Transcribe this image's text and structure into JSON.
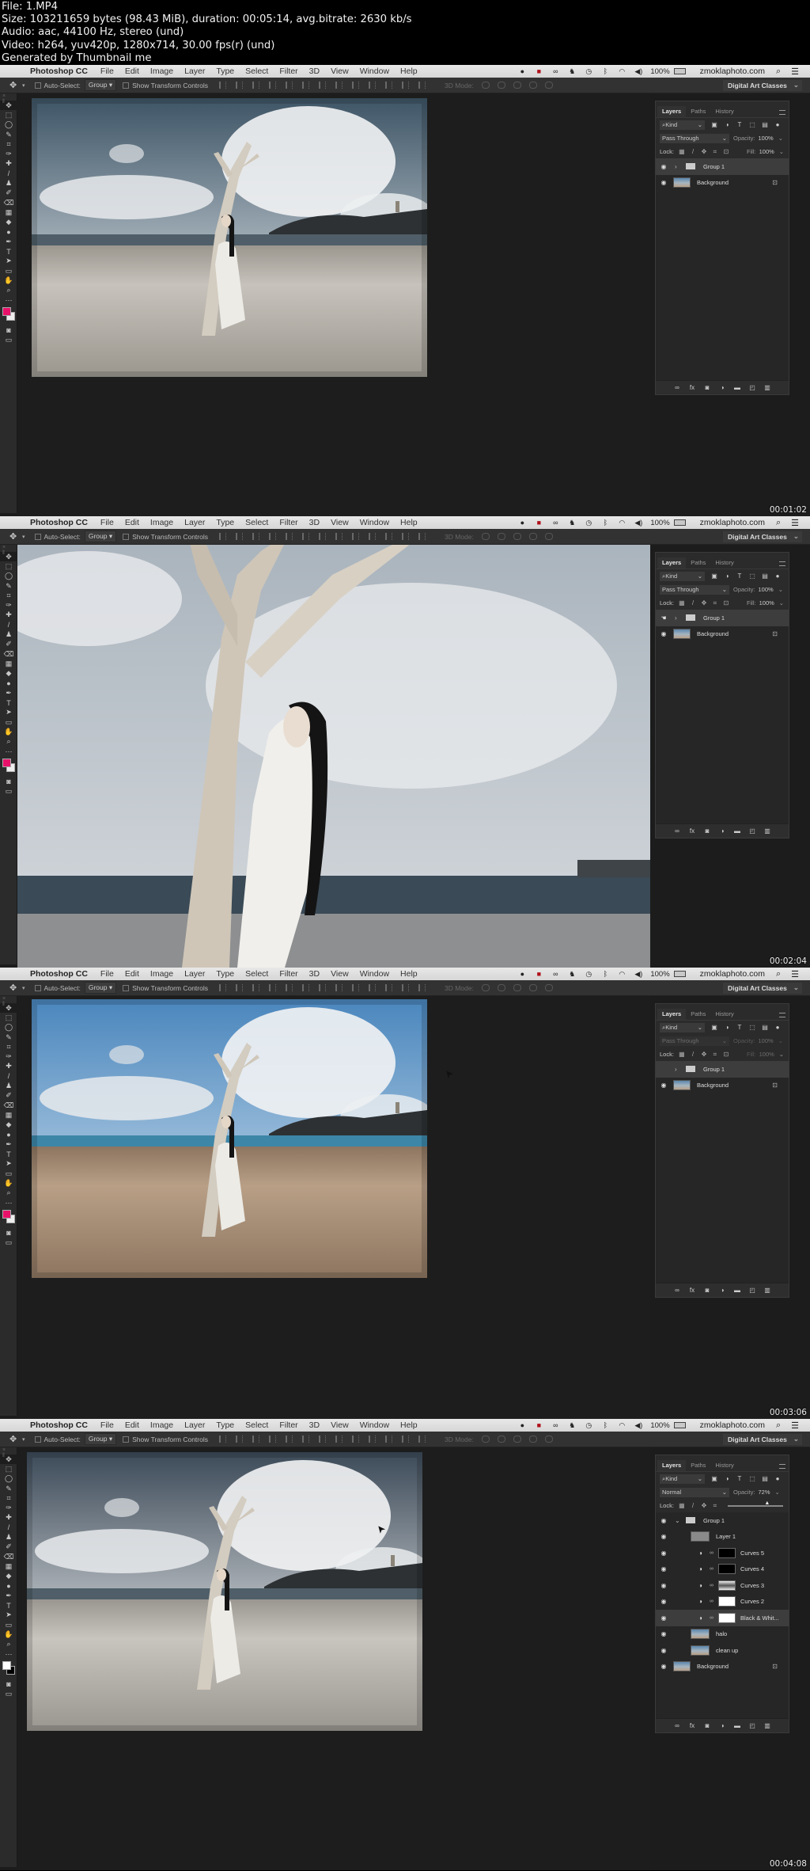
{
  "file_info": {
    "file": "File: 1.MP4",
    "size": "Size: 103211659 bytes (98.43 MiB), duration: 00:05:14, avg.bitrate: 2630 kb/s",
    "audio": "Audio: aac, 44100 Hz, stereo (und)",
    "video": "Video: h264, yuv420p, 1280x714, 30.00 fps(r) (und)",
    "generator": "Generated by Thumbnail me"
  },
  "menubar": {
    "app_name": "Photoshop CC",
    "items": [
      "File",
      "Edit",
      "Image",
      "Layer",
      "Type",
      "Select",
      "Filter",
      "3D",
      "View",
      "Window",
      "Help"
    ],
    "battery": "100%",
    "site": "zmoklaphoto.com"
  },
  "options_bar": {
    "auto_select_label": "Auto-Select:",
    "auto_select_value": "Group",
    "transform_label": "Show Transform Controls",
    "mode_label": "3D Mode:",
    "workspace": "Digital Art Classes"
  },
  "tools": [
    "move",
    "marquee",
    "lasso",
    "quick-select",
    "crop",
    "eyedropper",
    "healing",
    "brush",
    "stamp",
    "history-brush",
    "eraser",
    "gradient",
    "blur",
    "dodge",
    "pen",
    "type",
    "path-select",
    "rectangle",
    "hand",
    "zoom",
    "more"
  ],
  "panel": {
    "tabs": [
      "Layers",
      "Paths",
      "History"
    ],
    "kind_label": "Kind",
    "opacity_label": "Opacity:",
    "fill_label": "Fill:",
    "lock_label": "Lock:"
  },
  "frames": [
    {
      "timestamp": "00:01:02",
      "fg_color": "#e8116a",
      "bg_color": "#eeeeee",
      "blend_mode": "Pass Through",
      "opacity": "100%",
      "fill": "100%",
      "controls_dimmed": false,
      "layers": [
        {
          "name": "Group 1",
          "type": "group",
          "visible": true,
          "selected": true
        },
        {
          "name": "Background",
          "type": "image",
          "visible": true,
          "locked": true
        }
      ]
    },
    {
      "timestamp": "00:02:04",
      "fg_color": "#e8116a",
      "bg_color": "#eeeeee",
      "blend_mode": "Pass Through",
      "opacity": "100%",
      "fill": "100%",
      "controls_dimmed": false,
      "layers": [
        {
          "name": "Group 1",
          "type": "group",
          "visible": true,
          "selected": true
        },
        {
          "name": "Background",
          "type": "image",
          "visible": true,
          "locked": true
        }
      ]
    },
    {
      "timestamp": "00:03:06",
      "fg_color": "#e8116a",
      "bg_color": "#eeeeee",
      "blend_mode": "Pass Through",
      "opacity": "100%",
      "fill": "100%",
      "controls_dimmed": true,
      "layers": [
        {
          "name": "Group 1",
          "type": "group",
          "visible": false,
          "selected": true
        },
        {
          "name": "Background",
          "type": "image",
          "visible": true,
          "locked": true
        }
      ]
    },
    {
      "timestamp": "00:04:08",
      "fg_color": "#ffffff",
      "bg_color": "#000000",
      "blend_mode": "Normal",
      "opacity": "72%",
      "opacity_slider": 0.72,
      "controls_dimmed": false,
      "layers": [
        {
          "name": "Group 1",
          "type": "group-open",
          "visible": true
        },
        {
          "name": "Layer 1",
          "type": "gray",
          "visible": true
        },
        {
          "name": "Curves 5",
          "type": "adjust",
          "mask": "dark",
          "visible": true
        },
        {
          "name": "Curves 4",
          "type": "adjust",
          "mask": "dark",
          "visible": true
        },
        {
          "name": "Curves 3",
          "type": "adjust",
          "mask": "mid",
          "visible": true
        },
        {
          "name": "Curves 2",
          "type": "adjust",
          "mask": "light",
          "visible": true
        },
        {
          "name": "Black & Whit...",
          "type": "adjust",
          "mask": "light",
          "visible": true,
          "selected": true
        },
        {
          "name": "halo",
          "type": "image-indent",
          "visible": true
        },
        {
          "name": "clean up",
          "type": "image-indent",
          "visible": true
        },
        {
          "name": "Background",
          "type": "image",
          "visible": true,
          "locked": true
        }
      ]
    }
  ]
}
